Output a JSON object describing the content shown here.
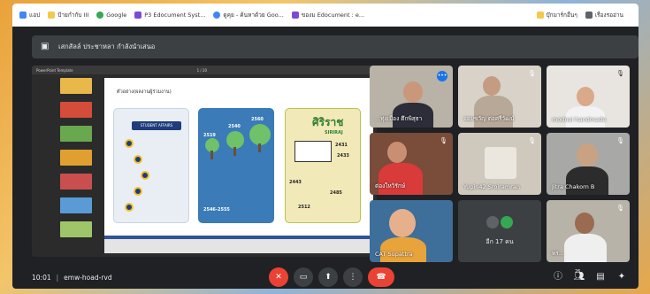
{
  "bookmarks": [
    {
      "label": "แอป",
      "color": "#4285f4"
    },
    {
      "label": "ป้ายกำกับ III",
      "color": "#f2c94c"
    },
    {
      "label": "Google",
      "color": "#34a853"
    },
    {
      "label": "P3 Edocument Syst...",
      "color": "#7b4bd6"
    },
    {
      "label": "ดูคุย - ค้นหาด้วย Goo...",
      "color": "#4285f4"
    },
    {
      "label": "ของม Edocument : e...",
      "color": "#7b4bd6"
    }
  ],
  "bookmarks_right": [
    {
      "label": "บุ๊กมาร์กอื่นๆ"
    },
    {
      "label": "เรื่องรออ่าน"
    }
  ],
  "presenter": {
    "label": "เสกสัลล์ ประชาหลา กำลังนำเสนอ"
  },
  "screen": {
    "app_title": "PowerPoint Template",
    "page_indicator": "1 / 20",
    "slide_title": "ตัวอย่าง(ผลงานผู้ร่วมงาน)",
    "panel1_header": "STUDENT AFFAIRS",
    "panel2_years": [
      "2519",
      "2540",
      "2560",
      "2546-2555"
    ],
    "panel3_name": "ศิริราช",
    "panel3_sub": "SIRIRAJ",
    "panel3_years": [
      "2431",
      "2433",
      "2443",
      "2485",
      "2512"
    ],
    "thumb_colors": [
      "#e9b84a",
      "#d44c3a",
      "#6aa84f",
      "#e0a030",
      "#c94f4f",
      "#5b9bd5",
      "#9fc56b",
      "#4a86c5"
    ]
  },
  "participants": [
    {
      "name": "...ทุ่งเมือง ตึกพิสุธา",
      "speaking": true
    },
    {
      "name": "จอมขวัญ ต่อศรีวัฒน์",
      "speaking": false
    },
    {
      "name": "modnoi handmade",
      "speaking": false
    },
    {
      "name": "ต่องใหวิรักษ์",
      "speaking": false
    },
    {
      "name": "Yupin42 Sroiramran",
      "speaking": false
    },
    {
      "name": "Jitra Chakorn B",
      "speaking": false
    },
    {
      "name": "CAT Supattra",
      "speaking": false
    },
    {
      "name": "อีก 17 คน",
      "speaking": false
    },
    {
      "name": "พร...",
      "speaking": false
    }
  ],
  "meeting": {
    "time": "10:01",
    "code": "emw-hoad-rvd",
    "participant_count": "26"
  },
  "colors": {
    "end_call": "#ea4335",
    "background": "#202124",
    "tile": "#3c4043"
  }
}
